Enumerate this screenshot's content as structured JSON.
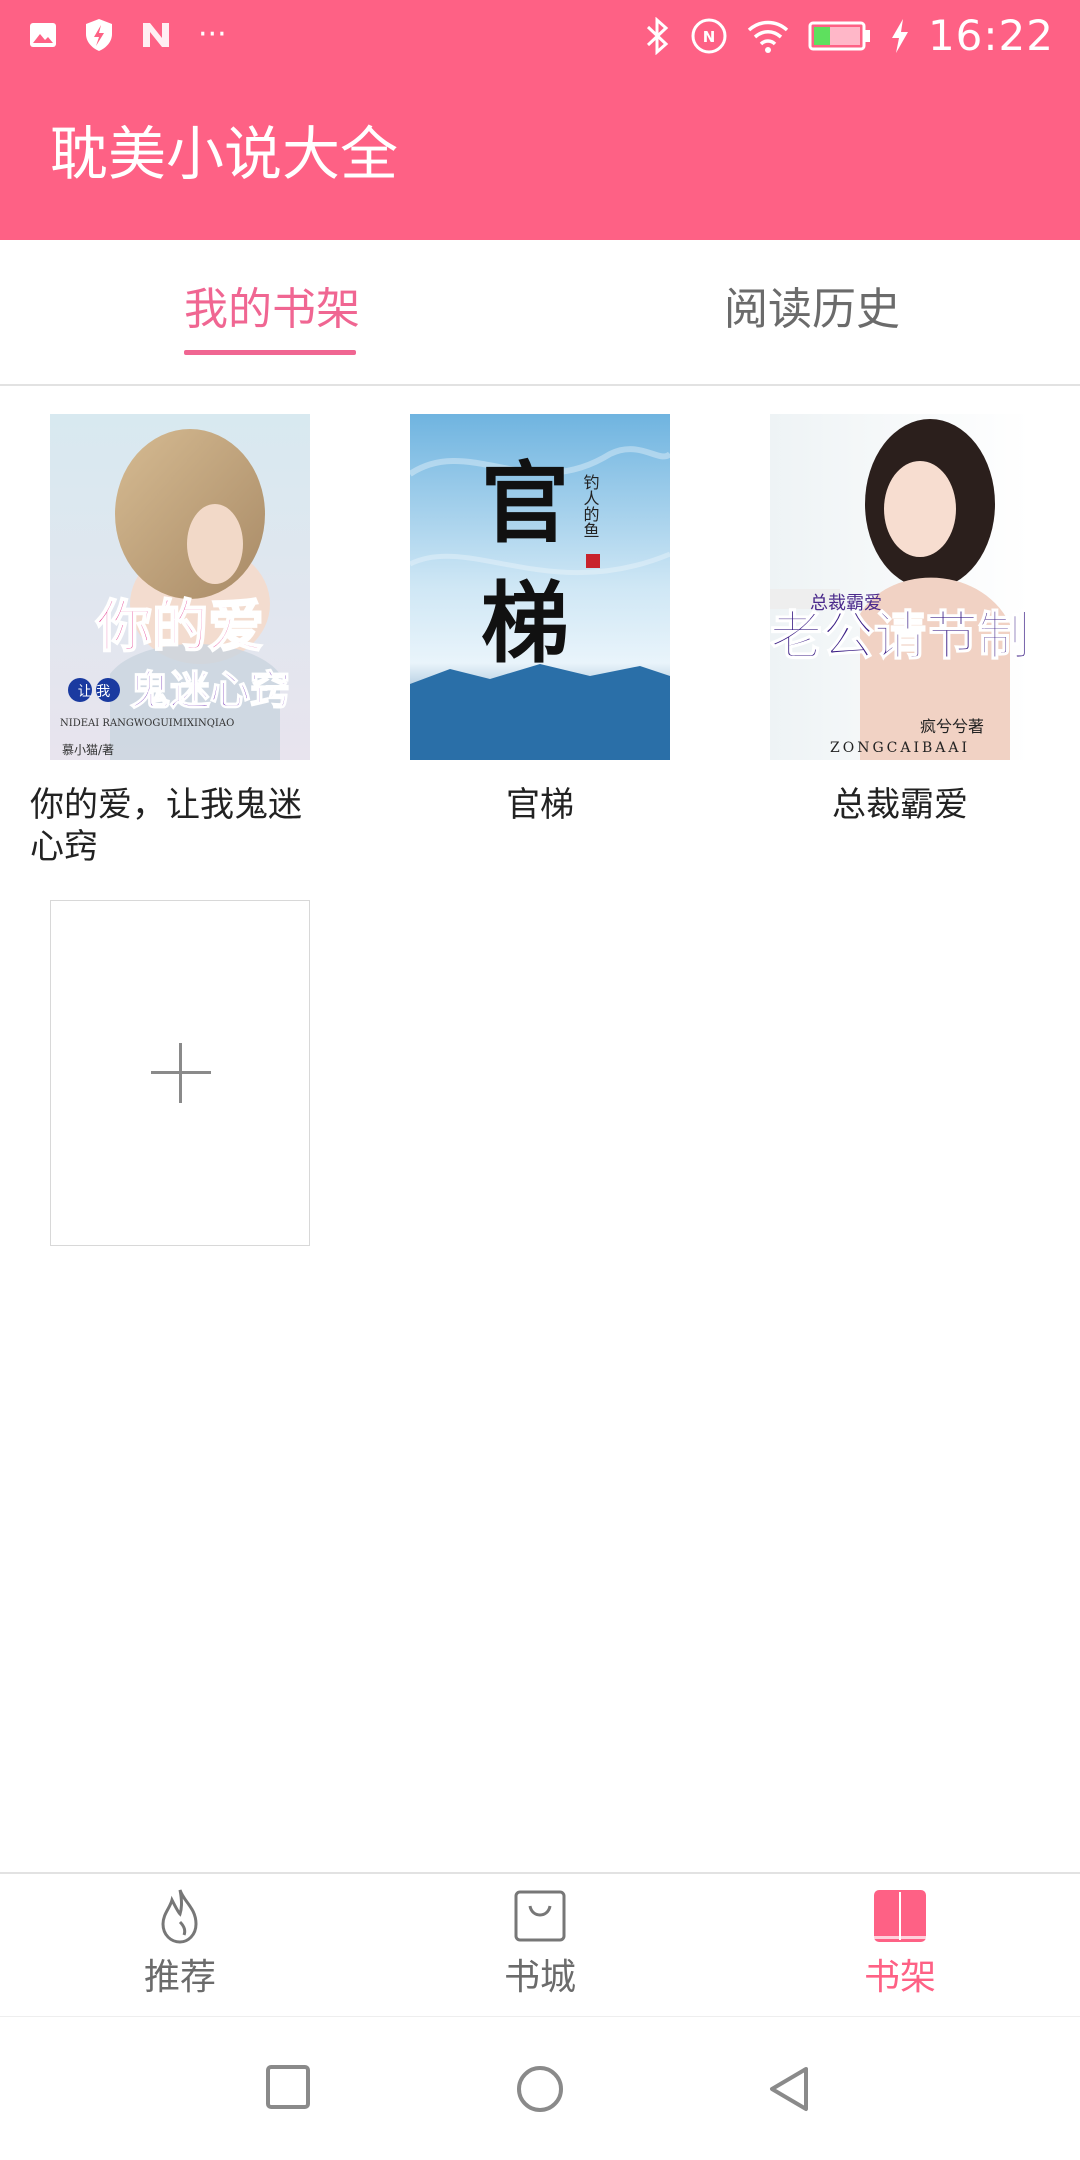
{
  "status_bar": {
    "time": "16:22",
    "left_icons": [
      "image-icon",
      "shield-bolt-icon",
      "n-app-icon",
      "more-dots-icon"
    ],
    "right_icons": [
      "bluetooth-icon",
      "nfc-icon",
      "wifi-icon",
      "battery-icon",
      "charging-bolt-icon"
    ],
    "battery_level_fraction": 0.35,
    "more_text": "···"
  },
  "header": {
    "title": "耽美小说大全",
    "background_color": "#fe6185"
  },
  "tabs": [
    {
      "label": "我的书架",
      "active": true
    },
    {
      "label": "阅读历史",
      "active": false
    }
  ],
  "books": [
    {
      "title": "你的爱，让我鬼迷心窍",
      "title_line1": "你的爱，让我鬼迷",
      "title_line2": "心窍",
      "cover_text_main": "你的爱",
      "cover_text_sub": "鬼迷心窍",
      "cover_text_small": "让 我",
      "cover_pinyin": "NIDEAI RANGWOGUIMIXINQIAO",
      "cover_author": "慕小猫/著"
    },
    {
      "title": "官梯",
      "cover_text_main": "官梯",
      "cover_author": "钓人的鱼"
    },
    {
      "title": "总裁霸爱",
      "cover_text_tag": "总裁霸爱",
      "cover_text_main": "老公请节制",
      "cover_author": "疯兮兮著",
      "cover_pinyin": "ZONGCAIBAAI"
    }
  ],
  "add_book": {
    "icon": "plus-icon"
  },
  "bottom_nav": [
    {
      "label": "推荐",
      "icon": "flame-icon",
      "active": false
    },
    {
      "label": "书城",
      "icon": "shopping-bag-icon",
      "active": false
    },
    {
      "label": "书架",
      "icon": "bookshelf-icon",
      "active": true
    }
  ],
  "system_nav": [
    "recent-apps-icon",
    "home-icon",
    "back-icon"
  ],
  "colors": {
    "accent": "#fe6185",
    "tab_active": "#f06692",
    "text_secondary": "#6b6b6b"
  }
}
